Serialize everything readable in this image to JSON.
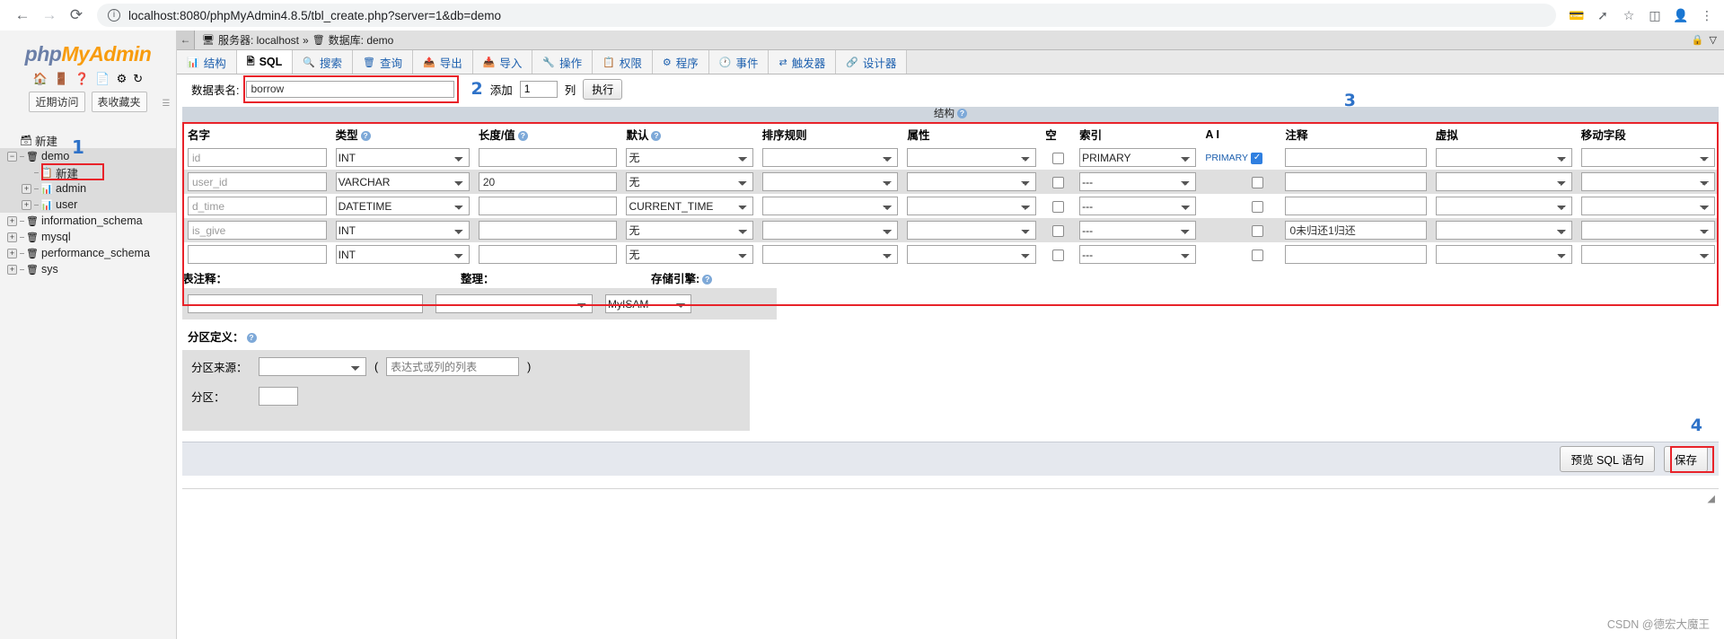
{
  "browser": {
    "back_icon": "←",
    "forward_icon": "→",
    "reload_icon": "⟳",
    "site_info_icon": "ⓘ",
    "url": "localhost:8080/phpMyAdmin4.8.5/tbl_create.php?server=1&db=demo",
    "toolbar_icons": [
      "payment-icon",
      "share-icon",
      "bookmark-star-icon",
      "sidepanel-icon",
      "profile-icon",
      "menu-icon"
    ]
  },
  "sidebar": {
    "logo_php": "php",
    "logo_my": "MyAdmin",
    "logo_icons": [
      "home-icon",
      "exit-icon",
      "help-icon",
      "docs-icon",
      "settings-icon",
      "reload-icon"
    ],
    "quick_buttons": [
      {
        "label": "近期访问"
      },
      {
        "label": "表收藏夹"
      }
    ],
    "collapse_handle_icon": "collapse-icon",
    "tree": [
      {
        "indent": 1,
        "toggle": "",
        "icon": "new-db-icon",
        "label": "新建",
        "highlight": false
      },
      {
        "indent": 1,
        "toggle": "−",
        "icon": "database-icon",
        "label": "demo",
        "highlight": true
      },
      {
        "indent": 2,
        "toggle": "",
        "icon": "new-table-icon",
        "label": "新建",
        "highlight": true
      },
      {
        "indent": 2,
        "toggle": "+",
        "icon": "table-icon",
        "label": "admin",
        "highlight": true
      },
      {
        "indent": 2,
        "toggle": "+",
        "icon": "table-icon",
        "label": "user",
        "highlight": true
      },
      {
        "indent": 1,
        "toggle": "+",
        "icon": "database-icon",
        "label": "information_schema",
        "highlight": false
      },
      {
        "indent": 1,
        "toggle": "+",
        "icon": "database-icon",
        "label": "mysql",
        "highlight": false
      },
      {
        "indent": 1,
        "toggle": "+",
        "icon": "database-icon",
        "label": "performance_schema",
        "highlight": false
      },
      {
        "indent": 1,
        "toggle": "+",
        "icon": "database-icon",
        "label": "sys",
        "highlight": false
      }
    ]
  },
  "breadcrumb": {
    "back_icon": "←",
    "server_icon": "server-icon",
    "server_text": "服务器: localhost",
    "separator": "»",
    "db_icon": "database-icon",
    "db_text": "数据库: demo",
    "right_icons": [
      "lock-icon",
      "minimize-icon"
    ]
  },
  "tabs": [
    {
      "icon": "structure-icon",
      "label": "结构",
      "active": false
    },
    {
      "icon": "sql-icon",
      "label": "SQL",
      "active": true
    },
    {
      "icon": "search-icon",
      "label": "搜索",
      "active": false
    },
    {
      "icon": "query-icon",
      "label": "查询",
      "active": false
    },
    {
      "icon": "export-icon",
      "label": "导出",
      "active": false
    },
    {
      "icon": "import-icon",
      "label": "导入",
      "active": false
    },
    {
      "icon": "operations-icon",
      "label": "操作",
      "active": false
    },
    {
      "icon": "privileges-icon",
      "label": "权限",
      "active": false
    },
    {
      "icon": "routines-icon",
      "label": "程序",
      "active": false
    },
    {
      "icon": "events-icon",
      "label": "事件",
      "active": false
    },
    {
      "icon": "triggers-icon",
      "label": "触发器",
      "active": false
    },
    {
      "icon": "designer-icon",
      "label": "设计器",
      "active": false
    }
  ],
  "form": {
    "table_name_label": "数据表名:",
    "table_name_value": "borrow",
    "add_label": "添加",
    "add_count": "1",
    "columns_label": "列",
    "go_label": "执行"
  },
  "structure": {
    "title": "结构",
    "help_icon": "help-icon",
    "headers": [
      "名字",
      "类型",
      "长度/值",
      "默认",
      "排序规则",
      "属性",
      "空",
      "索引",
      "A I",
      "注释",
      "虚拟",
      "移动字段"
    ],
    "rows": [
      {
        "name": "id",
        "name_placeholder": "id",
        "type": "INT",
        "length": "",
        "default": "无",
        "collation": "",
        "attributes": "",
        "null": false,
        "index": "PRIMARY",
        "index_note": "PRIMARY",
        "ai": true,
        "comment": "",
        "virtuality": "",
        "move": ""
      },
      {
        "name": "user_id",
        "name_placeholder": "user_id",
        "type": "VARCHAR",
        "length": "20",
        "default": "无",
        "collation": "",
        "attributes": "",
        "null": false,
        "index": "---",
        "index_note": "",
        "ai": false,
        "comment": "",
        "virtuality": "",
        "move": ""
      },
      {
        "name": "d_time",
        "name_placeholder": "d_time",
        "type": "DATETIME",
        "length": "",
        "default": "CURRENT_TIME",
        "collation": "",
        "attributes": "",
        "null": false,
        "index": "---",
        "index_note": "",
        "ai": false,
        "comment": "",
        "virtuality": "",
        "move": ""
      },
      {
        "name": "is_give",
        "name_placeholder": "is_give",
        "type": "INT",
        "length": "",
        "default": "无",
        "collation": "",
        "attributes": "",
        "null": false,
        "index": "---",
        "index_note": "",
        "ai": false,
        "comment": "0未归还1归还",
        "virtuality": "",
        "move": ""
      },
      {
        "name": "",
        "name_placeholder": "",
        "type": "INT",
        "length": "",
        "default": "无",
        "collation": "",
        "attributes": "",
        "null": false,
        "index": "---",
        "index_note": "",
        "ai": false,
        "comment": "",
        "virtuality": "",
        "move": ""
      }
    ]
  },
  "meta": {
    "comment_label": "表注释：",
    "comment_value": "",
    "collation_label": "整理：",
    "collation_value": "",
    "engine_label": "存储引擎:",
    "engine_help_icon": "help-icon",
    "engine_value": "MyISAM"
  },
  "partition": {
    "title_label": "分区定义：",
    "help_icon": "help-icon",
    "source_label": "分区来源：",
    "source_value": "",
    "paren_open": "(",
    "expression_placeholder": "表达式或列的列表",
    "paren_close": ")",
    "partitions_label": "分区：",
    "partitions_value": ""
  },
  "footer": {
    "preview_label": "预览 SQL 语句",
    "save_label": "保存",
    "resize_icon": "resize-icon"
  },
  "annotations": [
    {
      "number": "1",
      "target": "sidebar-new-table"
    },
    {
      "number": "2",
      "target": "table-name-input"
    },
    {
      "number": "3",
      "target": "structure-table"
    },
    {
      "number": "4",
      "target": "save-button"
    }
  ],
  "watermark": "CSDN @德宏大魔王",
  "colors": {
    "annotation_red": "#e8232a",
    "annotation_blue": "#2e72c8",
    "link_blue": "#1c5fae",
    "logo_orange": "#f89c0e"
  }
}
